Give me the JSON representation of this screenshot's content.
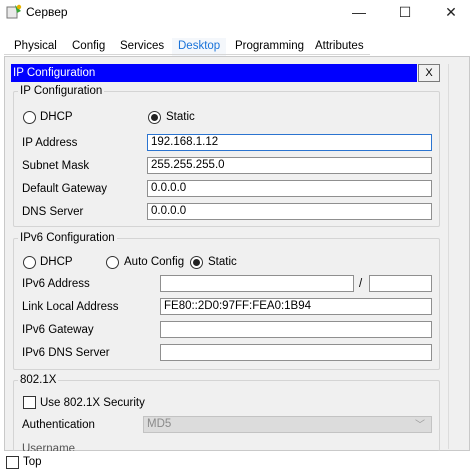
{
  "window": {
    "title": "Сервер",
    "minimize_glyph": "—",
    "maximize_glyph": "☐",
    "close_glyph": "✕"
  },
  "tabs": [
    {
      "label": "Physical",
      "active": false
    },
    {
      "label": "Config",
      "active": false
    },
    {
      "label": "Services",
      "active": false
    },
    {
      "label": "Desktop",
      "active": true
    },
    {
      "label": "Programming",
      "active": false
    },
    {
      "label": "Attributes",
      "active": false
    }
  ],
  "ip_config": {
    "header": "IP Configuration",
    "close_label": "X",
    "group_title": "IP Configuration",
    "dhcp_label": "DHCP",
    "static_label": "Static",
    "mode": "Static",
    "ip_address_label": "IP Address",
    "ip_address": "192.168.1.12",
    "subnet_mask_label": "Subnet Mask",
    "subnet_mask": "255.255.255.0",
    "default_gateway_label": "Default Gateway",
    "default_gateway": "0.0.0.0",
    "dns_server_label": "DNS Server",
    "dns_server": "0.0.0.0"
  },
  "ipv6_config": {
    "group_title": "IPv6 Configuration",
    "dhcp_label": "DHCP",
    "auto_config_label": "Auto Config",
    "static_label": "Static",
    "mode": "Static",
    "ipv6_address_label": "IPv6 Address",
    "ipv6_address": "",
    "prefix_separator": "/",
    "prefix_length": "",
    "link_local_label": "Link Local Address",
    "link_local": "FE80::2D0:97FF:FEA0:1B94",
    "ipv6_gateway_label": "IPv6 Gateway",
    "ipv6_gateway": "",
    "ipv6_dns_label": "IPv6 DNS Server",
    "ipv6_dns": ""
  },
  "dot1x": {
    "group_title": "802.1X",
    "use_label": "Use 802.1X Security",
    "use_checked": false,
    "auth_label": "Authentication",
    "auth_value": "MD5",
    "username_label": "Username"
  },
  "bottom": {
    "top_label": "Top",
    "top_checked": false
  },
  "colors": {
    "header_bar": "#0000ff",
    "active_tab": "#1a73d9"
  }
}
